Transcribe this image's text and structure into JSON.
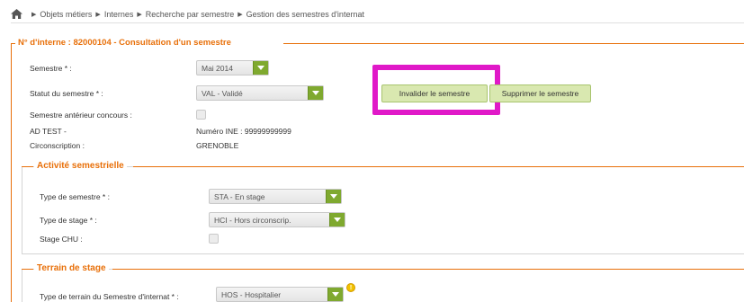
{
  "breadcrumb": {
    "items": [
      "Objets métiers",
      "Internes",
      "Recherche par semestre",
      "Gestion des semestres d'internat"
    ]
  },
  "main": {
    "title": "N° d'interne : 82000104 - Consultation d'un semestre",
    "semestre_label": "Semestre * :",
    "semestre_value": "Mai 2014",
    "statut_label": "Statut du semestre * :",
    "statut_value": "VAL - Validé",
    "anterieur_label": "Semestre antérieur concours :",
    "name_text": "AD TEST -",
    "ine_text": "Numéro INE : 99999999999",
    "circonscription_label": "Circonscription :",
    "circonscription_value": "GRENOBLE",
    "invalider_label": "Invalider le semestre",
    "supprimer_label": "Supprimer le semestre"
  },
  "activite": {
    "title": "Activité semestrielle",
    "type_semestre_label": "Type de semestre * :",
    "type_semestre_value": "STA - En stage",
    "type_stage_label": "Type de stage * :",
    "type_stage_value": "HCI - Hors circonscrip.",
    "stage_chu_label": "Stage CHU :"
  },
  "terrain": {
    "title": "Terrain de stage",
    "type_terrain_label": "Type de terrain du Semestre d'internat * :",
    "type_terrain_value": "HOS - Hospitalier"
  },
  "colors": {
    "accent": "#e8700a",
    "select_arrow": "#7fa92f",
    "button_bg": "#d9e8b0",
    "highlight": "#e019c8"
  },
  "icons": [
    "home-icon",
    "chevron-right-icon",
    "dropdown-arrow-icon",
    "info-icon"
  ]
}
